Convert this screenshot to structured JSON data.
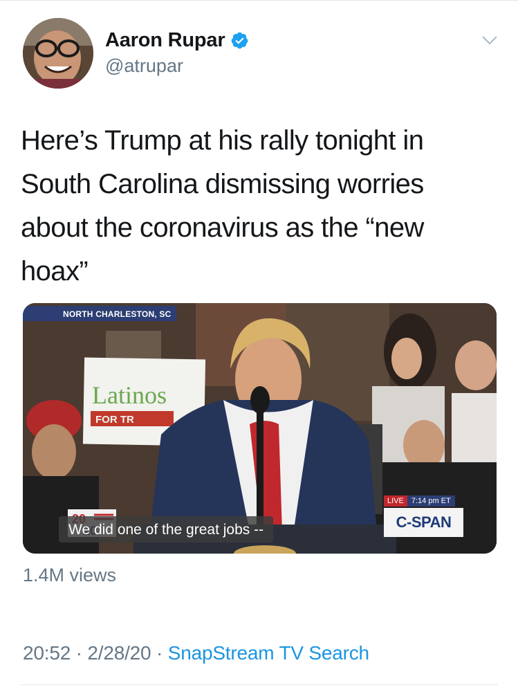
{
  "author": {
    "name": "Aaron Rupar",
    "handle": "@atrupar",
    "verified": true,
    "avatar_icon": "avatar-photo"
  },
  "tweet": {
    "text": "Here’s Trump at his rally tonight in South Carolina dismissing worries about the coronavirus as the “new hoax”"
  },
  "media": {
    "type": "video",
    "location_tag": "NORTH CHARLESTON, SC",
    "sign_text": "Latinos",
    "sign_subtext": "FOR TR",
    "caption": "We did one of the great jobs --",
    "live_label": "LIVE",
    "live_time": "7:14 pm ET",
    "network": "C-SPAN"
  },
  "stats": {
    "views": "1.4M views"
  },
  "meta": {
    "time": "20:52",
    "separator": "·",
    "date": "2/28/20",
    "source": "SnapStream TV Search"
  },
  "colors": {
    "link": "#1b95e0",
    "secondary_text": "#657786",
    "verified_badge": "#1da1f2",
    "cspan_blue": "#2c3e73",
    "live_red": "#c0272d"
  }
}
